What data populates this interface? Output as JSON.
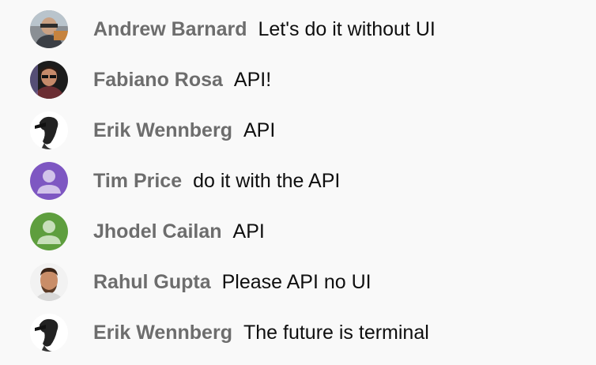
{
  "messages": [
    {
      "author": "Andrew Barnard",
      "text": "Let's do it without UI",
      "avatar_icon": "photo-avatar-icon"
    },
    {
      "author": "Fabiano Rosa",
      "text": "API!",
      "avatar_icon": "photo-avatar-icon"
    },
    {
      "author": "Erik Wennberg",
      "text": "API",
      "avatar_icon": "photo-avatar-icon"
    },
    {
      "author": "Tim Price",
      "text": "do it with the API",
      "avatar_icon": "default-person-avatar-icon",
      "avatar_color": "#7e57c2"
    },
    {
      "author": "Jhodel Cailan",
      "text": "API",
      "avatar_icon": "default-person-avatar-icon",
      "avatar_color": "#5e9e3e"
    },
    {
      "author": "Rahul Gupta",
      "text": "Please API no UI",
      "avatar_icon": "photo-avatar-icon"
    },
    {
      "author": "Erik Wennberg",
      "text": "The future is terminal",
      "avatar_icon": "photo-avatar-icon"
    }
  ],
  "colors": {
    "background": "#f9f9f9",
    "author": "#6d6d6d",
    "message": "#0f0f0f"
  }
}
